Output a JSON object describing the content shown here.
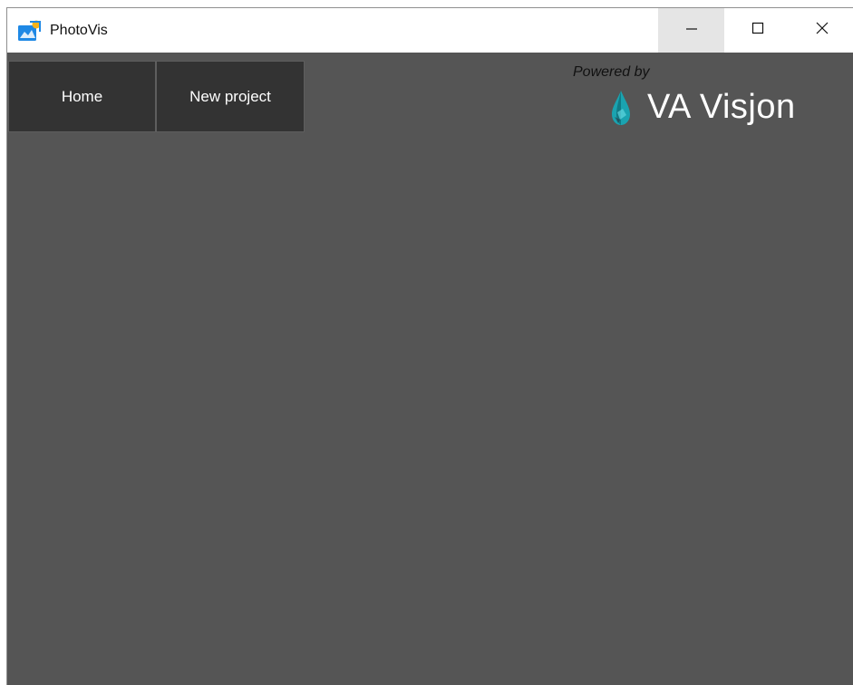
{
  "window": {
    "title": "PhotoVis",
    "app_icon": "photovis-app-icon",
    "controls": {
      "minimize_icon": "minimize-icon",
      "maximize_icon": "maximize-icon",
      "close_icon": "close-icon"
    }
  },
  "nav": {
    "home_label": "Home",
    "new_project_label": "New project"
  },
  "branding": {
    "powered_by": "Powered by",
    "brand_name": "VA Visjon",
    "logo_icon": "water-drop-icon"
  },
  "colors": {
    "client_background": "#555555",
    "nav_button_background": "#333333",
    "titlebar_background": "#ffffff",
    "logo_teal": "#1aa3b0"
  }
}
